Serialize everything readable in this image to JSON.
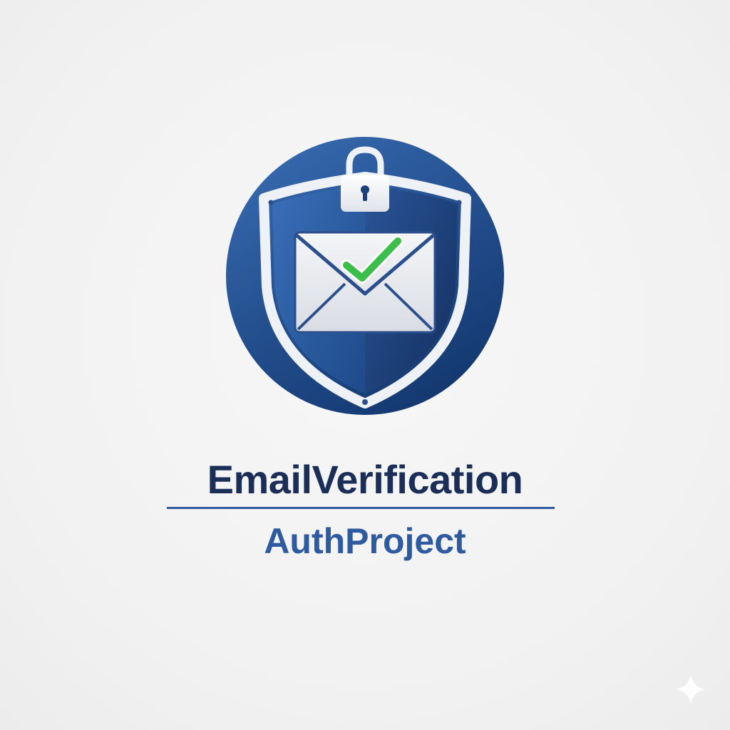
{
  "logo": {
    "title": "EmailVerification",
    "subtitle": "AuthProject",
    "icons": [
      "shield-icon",
      "padlock-icon",
      "envelope-icon",
      "checkmark-icon"
    ]
  },
  "colors": {
    "background": "#f2f2f2",
    "circle_light": "#3b6fb6",
    "circle_dark": "#153a72",
    "shield_outline": "#eef1f5",
    "envelope": "#eef0f3",
    "envelope_lines": "#2b4f8c",
    "check": "#3bbf4a",
    "title_text": "#1a2e57",
    "subtitle_text": "#2e5aa0",
    "divider": "#2f5aa0"
  },
  "decor": {
    "corner_mark": "sparkle-icon"
  }
}
